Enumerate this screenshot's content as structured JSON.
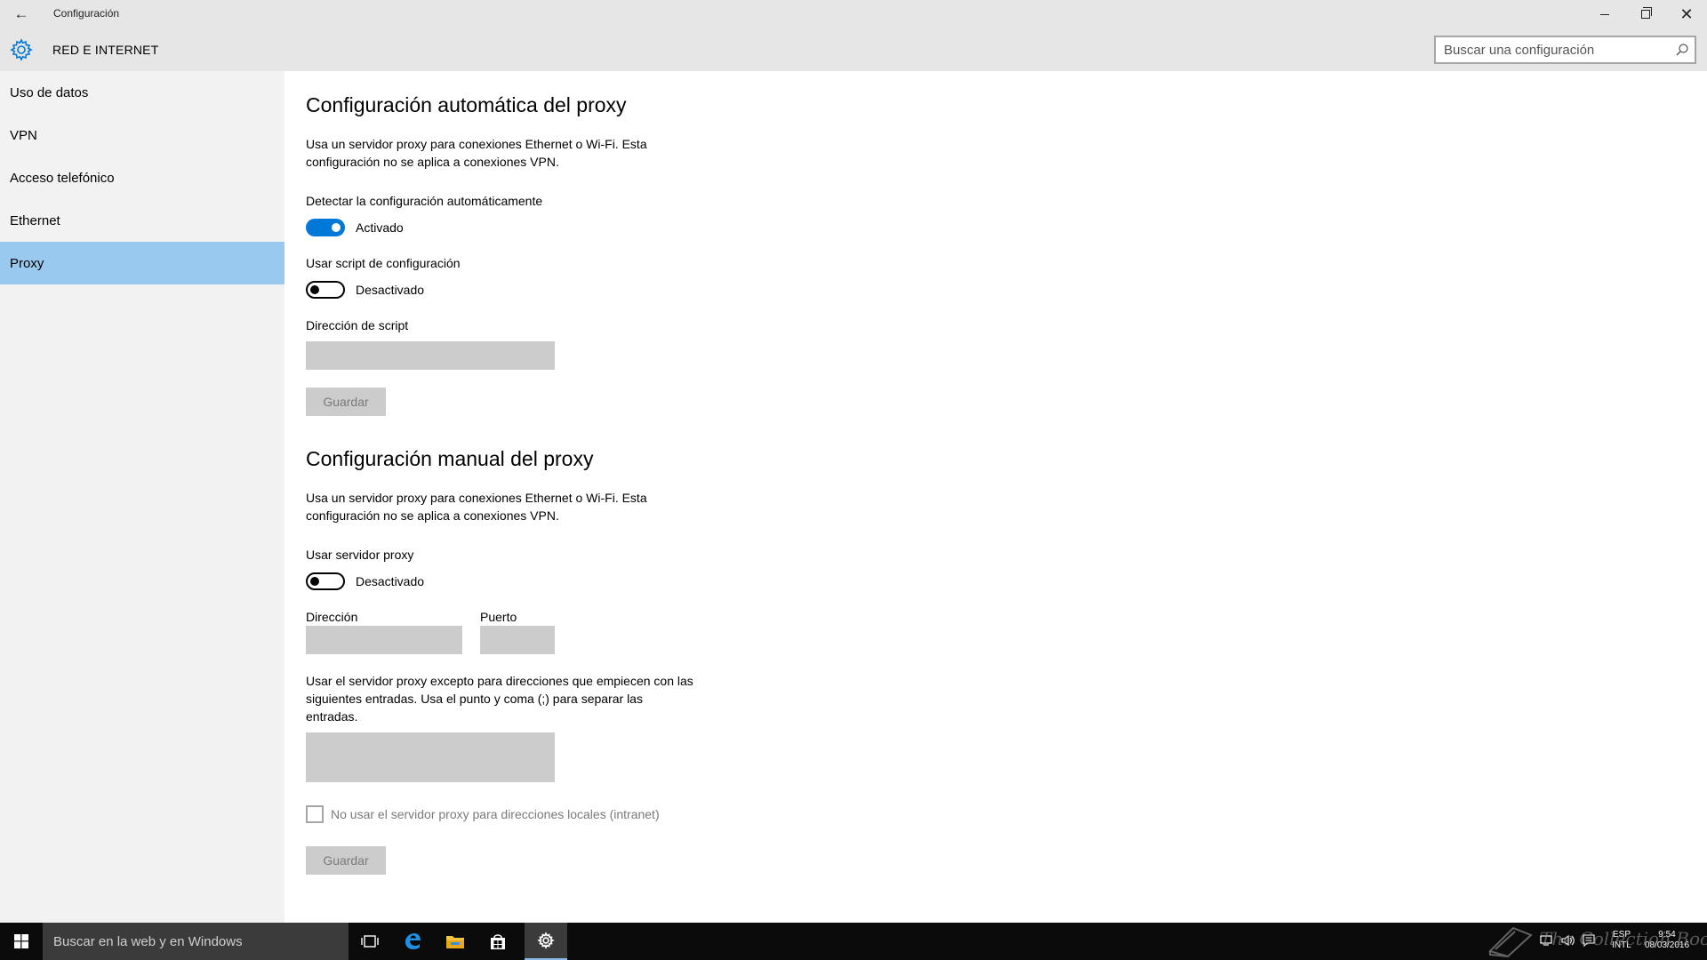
{
  "window": {
    "title": "Configuración"
  },
  "header": {
    "section": "RED E INTERNET",
    "search_placeholder": "Buscar una configuración"
  },
  "sidebar": {
    "items": [
      {
        "label": "Uso de datos"
      },
      {
        "label": "VPN"
      },
      {
        "label": "Acceso telefónico"
      },
      {
        "label": "Ethernet"
      },
      {
        "label": "Proxy",
        "selected": true
      }
    ]
  },
  "auto_proxy": {
    "heading": "Configuración automática del proxy",
    "description": "Usa un servidor proxy para conexiones Ethernet o Wi-Fi. Esta configuración no se aplica a conexiones VPN.",
    "detect_label": "Detectar la configuración automáticamente",
    "detect_state": "Activado",
    "detect_on": true,
    "script_label": "Usar script de configuración",
    "script_state": "Desactivado",
    "script_on": false,
    "script_address_label": "Dirección de script",
    "script_address_value": "",
    "save_label": "Guardar"
  },
  "manual_proxy": {
    "heading": "Configuración manual del proxy",
    "description": "Usa un servidor proxy para conexiones Ethernet o Wi-Fi. Esta configuración no se aplica a conexiones VPN.",
    "use_proxy_label": "Usar servidor proxy",
    "use_proxy_state": "Desactivado",
    "use_proxy_on": false,
    "address_label": "Dirección",
    "address_value": "",
    "port_label": "Puerto",
    "port_value": "",
    "exceptions_description": "Usar el servidor proxy excepto para direcciones que empiecen con las siguientes entradas. Usa el punto y coma (;) para separar las entradas.",
    "exceptions_value": "",
    "local_bypass_label": "No usar el servidor proxy para direcciones locales (intranet)",
    "local_bypass_checked": false,
    "save_label": "Guardar"
  },
  "taskbar": {
    "search_placeholder": "Buscar en la web y en Windows",
    "lang_primary": "ESP",
    "lang_secondary": "INTL",
    "time": "9:54",
    "date": "08/03/2016"
  },
  "watermark": {
    "text": "The Collection Book"
  },
  "colors": {
    "accent": "#0078d7",
    "selection": "#99c9ef",
    "chrome": "#e6e6e6",
    "sidebar": "#f2f2f2",
    "disabled_field": "#cccccc",
    "taskbar": "#0b0b0b"
  },
  "icons": {
    "back": "arrow-left-icon",
    "app": "gear-icon",
    "search": "magnifier-icon",
    "start": "windows-logo-icon",
    "task_view": "task-view-icon",
    "edge": "edge-browser-icon",
    "explorer": "file-explorer-icon",
    "store": "store-icon",
    "settings": "settings-gear-icon"
  }
}
